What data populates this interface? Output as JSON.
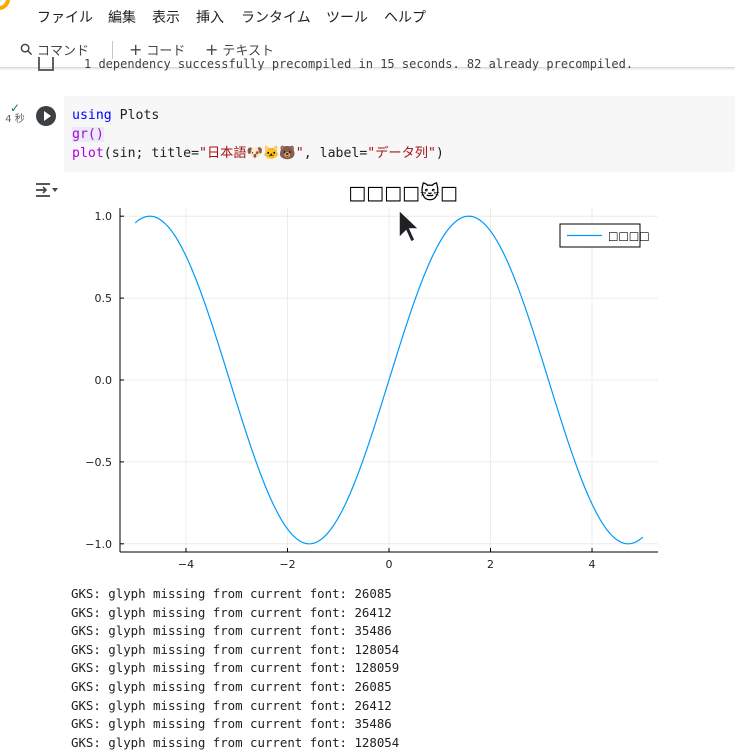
{
  "menu": {
    "items": [
      "ファイル",
      "編集",
      "表示",
      "挿入",
      "ランタイム",
      "ツール",
      "ヘルプ"
    ]
  },
  "toolbar": {
    "command_label": "コマンド",
    "add_code_label": "コード",
    "add_text_label": "テキスト"
  },
  "previous_output": {
    "text": "1 dependency successfully precompiled in 15 seconds. 82 already precompiled."
  },
  "cell": {
    "exec_time": "4 秒",
    "code_line1_kw": "using",
    "code_line1_rest": " Plots",
    "code_line2": "gr()",
    "code_line3_fn": "plot",
    "code_line3_a": "(sin; title=",
    "code_line3_title": "\"日本語🐶🐱🐻\"",
    "code_line3_b": ", label=",
    "code_line3_label": "\"データ列\"",
    "code_line3_c": ")"
  },
  "chart_data": {
    "type": "line",
    "title": "□□□□🐱□",
    "xlabel": "",
    "ylabel": "",
    "xlim": [
      -5.3,
      5.3
    ],
    "ylim": [
      -1.05,
      1.05
    ],
    "xticks": [
      -4,
      -2,
      0,
      2,
      4
    ],
    "xtick_labels": [
      "−4",
      "−2",
      "0",
      "2",
      "4"
    ],
    "yticks": [
      -1.0,
      -0.5,
      0.0,
      0.5,
      1.0
    ],
    "ytick_labels": [
      "−1.0",
      "−0.5",
      "0.0",
      "0.5",
      "1.0"
    ],
    "grid": true,
    "legend_position": "top-right",
    "series": [
      {
        "name": "□□□□",
        "color": "#009af9",
        "function": "sin",
        "x_range": [
          -5.0,
          5.0
        ]
      }
    ]
  },
  "log": {
    "lines": [
      "GKS: glyph missing from current font: 26085",
      "GKS: glyph missing from current font: 26412",
      "GKS: glyph missing from current font: 35486",
      "GKS: glyph missing from current font: 128054",
      "GKS: glyph missing from current font: 128059",
      "GKS: glyph missing from current font: 26085",
      "GKS: glyph missing from current font: 26412",
      "GKS: glyph missing from current font: 35486",
      "GKS: glyph missing from current font: 128054"
    ]
  }
}
